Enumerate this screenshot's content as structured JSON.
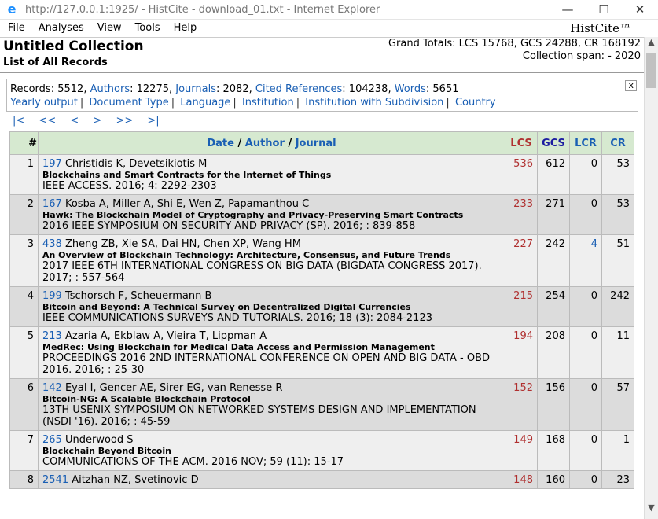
{
  "window": {
    "title": "http://127.0.0.1:1925/ - HistCite - download_01.txt - Internet Explorer",
    "controls": [
      "—",
      "☐",
      "✕"
    ]
  },
  "menu": {
    "items": [
      "File",
      "Analyses",
      "View",
      "Tools",
      "Help"
    ],
    "brand": "HistCite™"
  },
  "header": {
    "collection_title": "Untitled Collection",
    "subtitle": "List of All Records",
    "totals": "Grand Totals: LCS 15768, GCS 24288, CR 168192",
    "span": "Collection span: - 2020"
  },
  "info": {
    "records_label": "Records",
    "records": "5512",
    "authors_label": "Authors",
    "authors": "12275",
    "journals_label": "Journals",
    "journals": "2082",
    "cited_label": "Cited References",
    "cited": "104238",
    "words_label": "Words",
    "words": "5651",
    "links": [
      "Yearly output",
      "Document Type",
      "Language",
      "Institution",
      "Institution with Subdivision",
      "Country"
    ],
    "close": "x"
  },
  "pager": [
    "|<",
    "<<",
    "<",
    ">",
    ">>",
    ">|"
  ],
  "table": {
    "headers": {
      "num": "#",
      "date": "Date",
      "author": "Author",
      "journal": "Journal",
      "lcs": "LCS",
      "gcs": "GCS",
      "lcr": "LCR",
      "cr": "CR"
    },
    "rows": [
      {
        "n": "1",
        "id": "197",
        "authors": "Christidis K, Devetsikiotis M",
        "title": "Blockchains and Smart Contracts for the Internet of Things",
        "journal": "IEEE ACCESS. 2016; 4: 2292-2303",
        "lcs": "536",
        "gcs": "612",
        "lcr": "0",
        "cr": "53"
      },
      {
        "n": "2",
        "id": "167",
        "authors": "Kosba A, Miller A, Shi E, Wen Z, Papamanthou C",
        "title": "Hawk: The Blockchain Model of Cryptography and Privacy-Preserving Smart Contracts",
        "journal": "2016 IEEE SYMPOSIUM ON SECURITY AND PRIVACY (SP). 2016; : 839-858",
        "lcs": "233",
        "gcs": "271",
        "lcr": "0",
        "cr": "53"
      },
      {
        "n": "3",
        "id": "438",
        "authors": "Zheng ZB, Xie SA, Dai HN, Chen XP, Wang HM",
        "title": "An Overview of Blockchain Technology: Architecture, Consensus, and Future Trends",
        "journal": "2017 IEEE 6TH INTERNATIONAL CONGRESS ON BIG DATA (BIGDATA CONGRESS 2017). 2017; : 557-564",
        "lcs": "227",
        "gcs": "242",
        "lcr": "4",
        "cr": "51"
      },
      {
        "n": "4",
        "id": "199",
        "authors": "Tschorsch F, Scheuermann B",
        "title": "Bitcoin and Beyond: A Technical Survey on Decentralized Digital Currencies",
        "journal": "IEEE COMMUNICATIONS SURVEYS AND TUTORIALS. 2016; 18 (3): 2084-2123",
        "lcs": "215",
        "gcs": "254",
        "lcr": "0",
        "cr": "242"
      },
      {
        "n": "5",
        "id": "213",
        "authors": "Azaria A, Ekblaw A, Vieira T, Lippman A",
        "title": "MedRec: Using Blockchain for Medical Data Access and Permission Management",
        "journal": "PROCEEDINGS 2016 2ND INTERNATIONAL CONFERENCE ON OPEN AND BIG DATA - OBD 2016. 2016; : 25-30",
        "lcs": "194",
        "gcs": "208",
        "lcr": "0",
        "cr": "11"
      },
      {
        "n": "6",
        "id": "142",
        "authors": "Eyal I, Gencer AE, Sirer EG, van Renesse R",
        "title": "Bitcoin-NG: A Scalable Blockchain Protocol",
        "journal": "13TH USENIX SYMPOSIUM ON NETWORKED SYSTEMS DESIGN AND IMPLEMENTATION (NSDI '16). 2016; : 45-59",
        "lcs": "152",
        "gcs": "156",
        "lcr": "0",
        "cr": "57"
      },
      {
        "n": "7",
        "id": "265",
        "authors": "Underwood S",
        "title": "Blockchain Beyond Bitcoin",
        "journal": "COMMUNICATIONS OF THE ACM. 2016 NOV; 59 (11): 15-17",
        "lcs": "149",
        "gcs": "168",
        "lcr": "0",
        "cr": "1"
      },
      {
        "n": "8",
        "id": "2541",
        "authors": "Aitzhan NZ, Svetinovic D",
        "title": "",
        "journal": "",
        "lcs": "148",
        "gcs": "160",
        "lcr": "0",
        "cr": "23"
      }
    ]
  }
}
